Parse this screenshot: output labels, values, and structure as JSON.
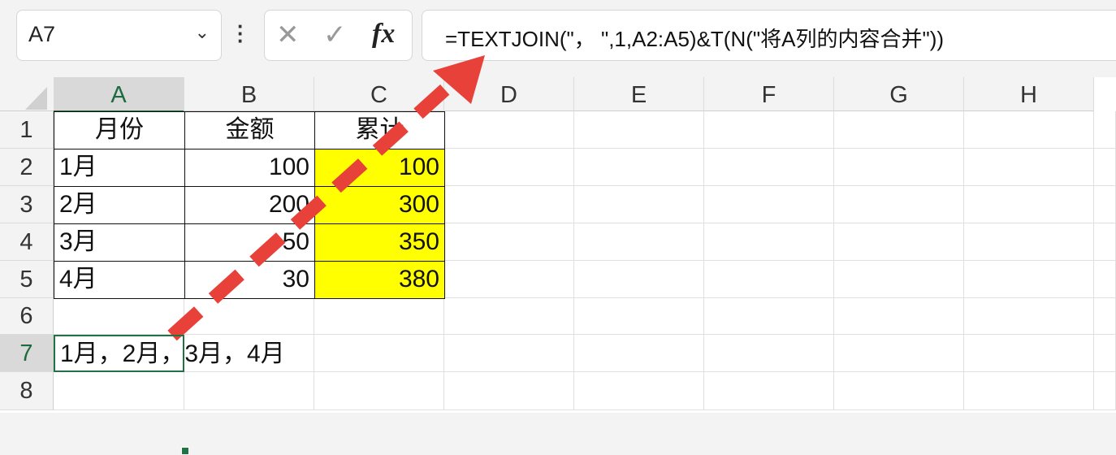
{
  "name_box": {
    "value": "A7"
  },
  "formula_buttons": {
    "cancel": "✕",
    "enter": "✓",
    "fx": "fx"
  },
  "formula_bar": {
    "value": "=TEXTJOIN(\"， \",1,A2:A5)&T(N(\"将A列的内容合并\"))"
  },
  "columns": [
    "A",
    "B",
    "C",
    "D",
    "E",
    "F",
    "G",
    "H"
  ],
  "rows": [
    "1",
    "2",
    "3",
    "4",
    "5",
    "6",
    "7",
    "8"
  ],
  "table": {
    "headers": [
      "月份",
      "金额",
      "累计"
    ],
    "rows": [
      [
        "1月",
        "100",
        "100"
      ],
      [
        "2月",
        "200",
        "300"
      ],
      [
        "3月",
        "50",
        "350"
      ],
      [
        "4月",
        "30",
        "380"
      ]
    ]
  },
  "a7": "1月，2月，3月，4月",
  "colors": {
    "highlight": "#ffff00",
    "selection": "#217346",
    "arrow": "#e8413a"
  }
}
